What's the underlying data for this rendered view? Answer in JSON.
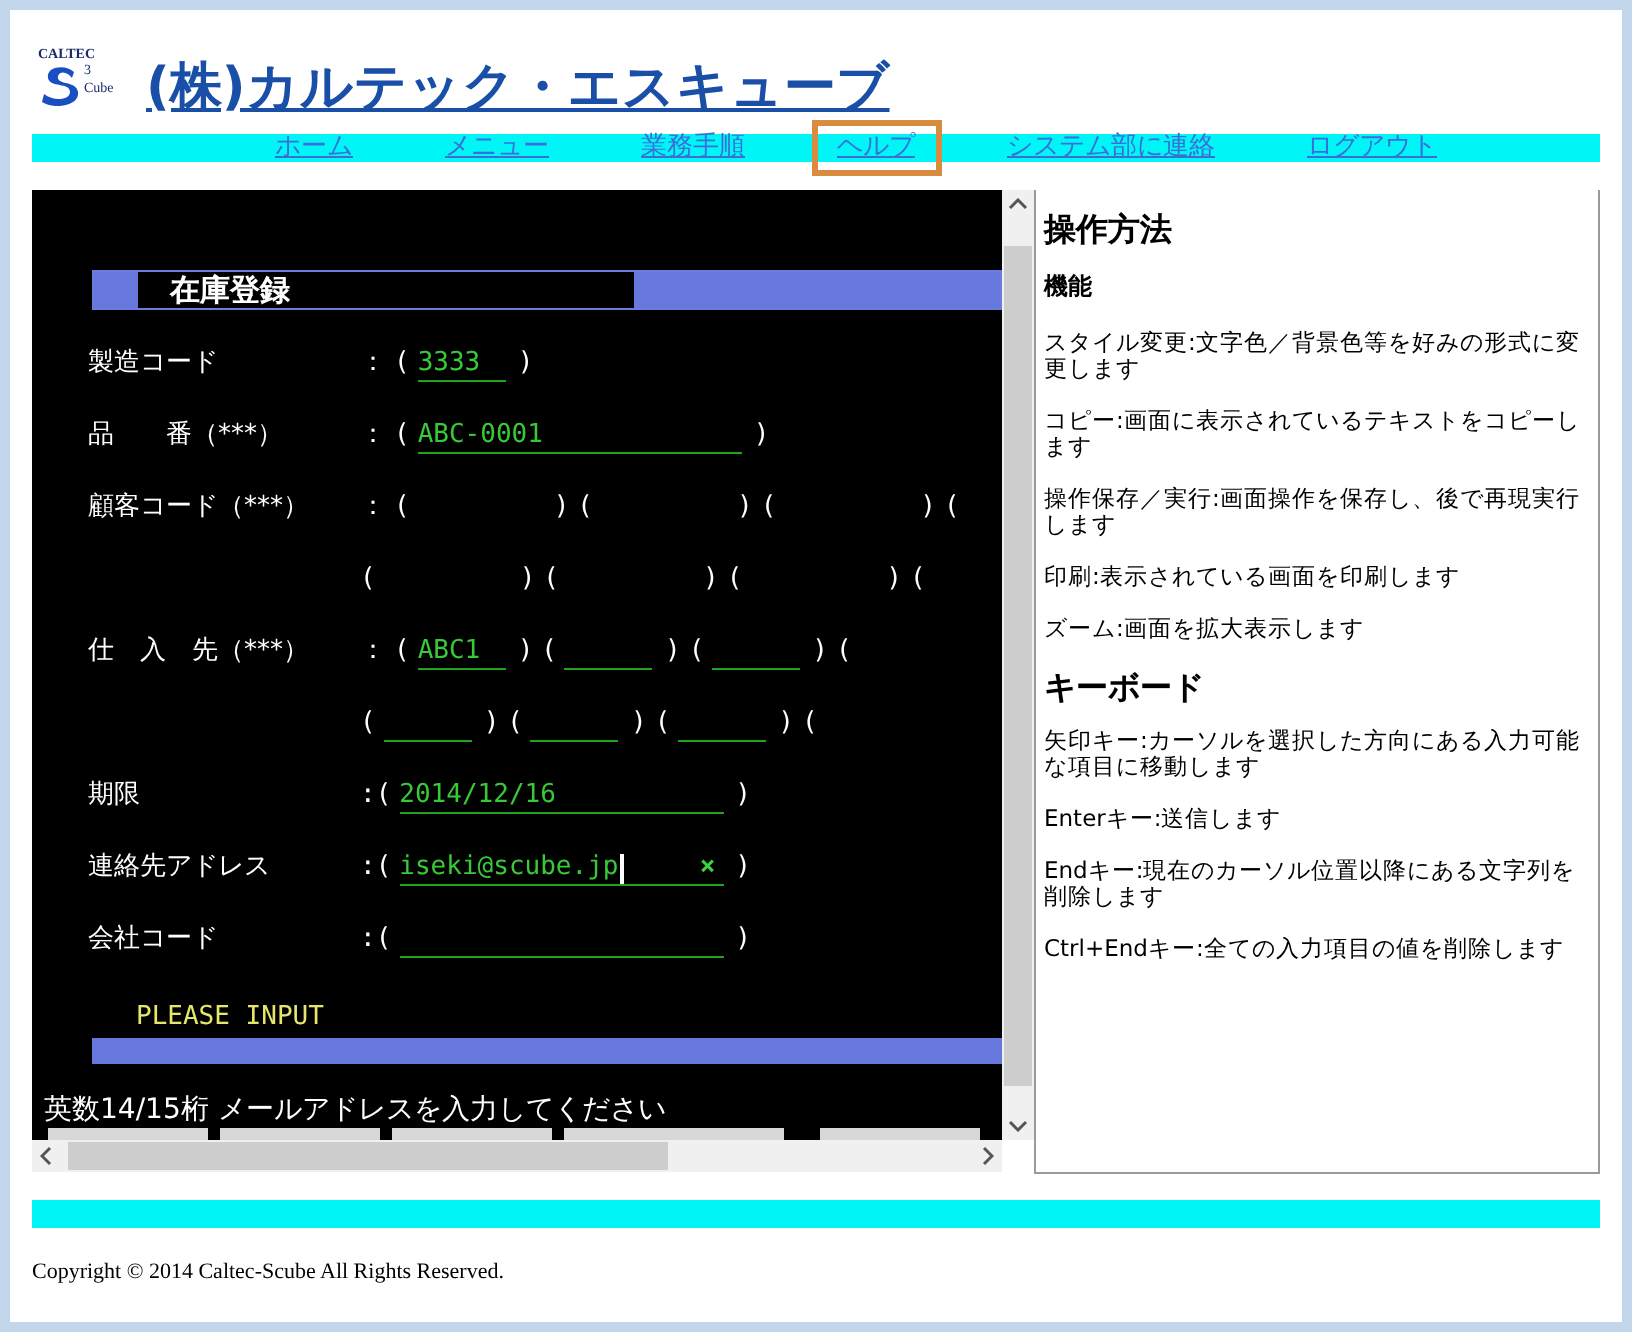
{
  "logo": {
    "top": "CALTEC",
    "mark": "3",
    "bottom": "Cube"
  },
  "site_title": "(株)カルテック・エスキューブ",
  "nav": [
    {
      "label": "ホーム",
      "selected": false
    },
    {
      "label": "メニュー",
      "selected": false
    },
    {
      "label": "業務手順",
      "selected": false
    },
    {
      "label": "ヘルプ",
      "selected": true
    },
    {
      "label": "システム部に連絡",
      "selected": false
    },
    {
      "label": "ログアウト",
      "selected": false
    }
  ],
  "terminal": {
    "screen_title": "在庫登録",
    "rows": [
      {
        "label": "製造コード",
        "segments": [
          {
            "kind": "text",
            "text": "："
          },
          {
            "kind": "text",
            "text": "("
          },
          {
            "kind": "short_input",
            "value": "3333"
          },
          {
            "kind": "text",
            "text": ")"
          }
        ]
      },
      {
        "label": "品　　番（***）",
        "segments": [
          {
            "kind": "text",
            "text": "："
          },
          {
            "kind": "text",
            "text": "("
          },
          {
            "kind": "long_input",
            "value": "ABC-0001"
          },
          {
            "kind": "text",
            "text": ")"
          }
        ]
      },
      {
        "label": "顧客コード（***）",
        "segments": [
          {
            "kind": "text",
            "text": "："
          },
          {
            "kind": "text",
            "text": "("
          },
          {
            "kind": "blank"
          },
          {
            "kind": "text",
            "text": ")"
          },
          {
            "kind": "text",
            "text": "("
          },
          {
            "kind": "blank"
          },
          {
            "kind": "text",
            "text": ")"
          },
          {
            "kind": "text",
            "text": "("
          },
          {
            "kind": "blank"
          },
          {
            "kind": "text",
            "text": ")"
          },
          {
            "kind": "text",
            "text": "("
          }
        ]
      },
      {
        "segments": [
          {
            "kind": "text",
            "text": "("
          },
          {
            "kind": "blank"
          },
          {
            "kind": "text",
            "text": ")"
          },
          {
            "kind": "text",
            "text": "("
          },
          {
            "kind": "blank"
          },
          {
            "kind": "text",
            "text": ")"
          },
          {
            "kind": "text",
            "text": "("
          },
          {
            "kind": "blank"
          },
          {
            "kind": "text",
            "text": ")"
          },
          {
            "kind": "text",
            "text": "("
          }
        ]
      },
      {
        "label": "仕　入　先（***）",
        "segments": [
          {
            "kind": "text",
            "text": "："
          },
          {
            "kind": "text",
            "text": "("
          },
          {
            "kind": "short_input",
            "value": "ABC1"
          },
          {
            "kind": "text",
            "text": ")"
          },
          {
            "kind": "text",
            "text": "("
          },
          {
            "kind": "short_input"
          },
          {
            "kind": "text",
            "text": ")"
          },
          {
            "kind": "text",
            "text": "("
          },
          {
            "kind": "short_input"
          },
          {
            "kind": "text",
            "text": ")"
          },
          {
            "kind": "text",
            "text": "("
          }
        ]
      },
      {
        "segments": [
          {
            "kind": "text",
            "text": "("
          },
          {
            "kind": "short_input"
          },
          {
            "kind": "text",
            "text": ")"
          },
          {
            "kind": "text",
            "text": "("
          },
          {
            "kind": "short_input"
          },
          {
            "kind": "text",
            "text": ")"
          },
          {
            "kind": "text",
            "text": "("
          },
          {
            "kind": "short_input"
          },
          {
            "kind": "text",
            "text": ")"
          },
          {
            "kind": "text",
            "text": "("
          }
        ]
      },
      {
        "label": "期限",
        "segments": [
          {
            "kind": "text",
            "text": ":("
          },
          {
            "kind": "long_input",
            "value": "2014/12/16"
          },
          {
            "kind": "text",
            "text": ")"
          }
        ]
      },
      {
        "label": "連絡先アドレス",
        "segments": [
          {
            "kind": "text",
            "text": ":("
          },
          {
            "kind": "long_input",
            "value": "iseki@scube.jp",
            "focused": true,
            "clear": "×"
          },
          {
            "kind": "text",
            "text": ")"
          }
        ]
      },
      {
        "label": "会社コード",
        "segments": [
          {
            "kind": "text",
            "text": ":("
          },
          {
            "kind": "long_input"
          },
          {
            "kind": "text",
            "text": ")"
          }
        ]
      }
    ],
    "prompt": "PLEASE INPUT",
    "message": "英数14/15桁 メールアドレスを入力してください"
  },
  "help": [
    {
      "kind": "title",
      "text": "操作方法"
    },
    {
      "kind": "subheading",
      "text": "機能"
    },
    {
      "kind": "paragraph",
      "text": "スタイル変更:文字色／背景色等を好みの形式に変更します"
    },
    {
      "kind": "paragraph",
      "text": "コピー:画面に表示されているテキストをコピーします"
    },
    {
      "kind": "paragraph",
      "text": "操作保存／実行:画面操作を保存し、後で再現実行します"
    },
    {
      "kind": "paragraph",
      "text": "印刷:表示されている画面を印刷します"
    },
    {
      "kind": "paragraph",
      "text": "ズーム:画面を拡大表示します"
    },
    {
      "kind": "title",
      "text": "キーボード"
    },
    {
      "kind": "paragraph",
      "text": "矢印キー:カーソルを選択した方向にある入力可能な項目に移動します"
    },
    {
      "kind": "paragraph",
      "text": "Enterキー:送信します"
    },
    {
      "kind": "paragraph",
      "text": "Endキー:現在のカーソル位置以降にある文字列を削除します"
    },
    {
      "kind": "paragraph",
      "text": "Ctrl+Endキー:全ての入力項目の値を削除します"
    }
  ],
  "copyright": "Copyright © 2014 Caltec-Scube All Rights Reserved."
}
